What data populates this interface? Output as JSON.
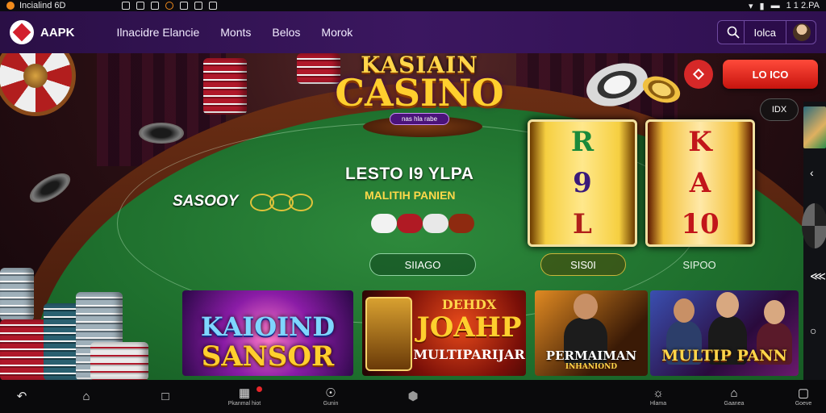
{
  "status_bar": {
    "app_name": "Incialind 6D",
    "time": "1 1 2.PA"
  },
  "navbar": {
    "brand": "AAPK",
    "links": [
      "Ilnacidre Elancie",
      "Monts",
      "Belos",
      "Morok"
    ],
    "login_label": "Iolca"
  },
  "hero": {
    "logo_line1": "KASIAIN",
    "logo_line2": "CASINO",
    "logo_badge": "nas hla rabe",
    "headline": "LESTO I9 YLPA",
    "subline": "MALITIH PANIEN",
    "left_text": "SASOOY",
    "cta_label": "LO ICO",
    "speed_label": "IDX",
    "buttons": [
      "SIIAGO",
      "SIS0I",
      "SIPOO"
    ]
  },
  "reels": [
    [
      "R",
      "9",
      "L"
    ],
    [
      "K",
      "A",
      "10"
    ]
  ],
  "cards": [
    {
      "line1": "KAIOIND",
      "line2": "SANSOR"
    },
    {
      "line1": "JOAHP",
      "line2": "MULTIPARIJAR",
      "top": "DEHDX"
    },
    {
      "line1": "PERMAIMAN",
      "line2": "INHANIOND"
    },
    {
      "line1": "MULTIP PANN",
      "line2": ""
    }
  ],
  "bottom_nav": {
    "items": [
      {
        "icon": "back-icon",
        "label": ""
      },
      {
        "icon": "home-icon",
        "label": ""
      },
      {
        "icon": "tabs-icon",
        "label": ""
      },
      {
        "icon": "games-icon",
        "label": "Pkanmal hiot"
      },
      {
        "icon": "compass-icon",
        "label": "Gunin"
      },
      {
        "icon": "shield-icon",
        "label": ""
      },
      {
        "icon": "explore-icon",
        "label": "Hlama"
      },
      {
        "icon": "profile-icon",
        "label": "Gaanea"
      },
      {
        "icon": "square-icon",
        "label": "Goeve"
      }
    ]
  },
  "colors": {
    "nav_bg": "#2a0f45",
    "accent_red": "#d62828",
    "gold": "#ffcf2e",
    "felt": "#1c6b2b"
  }
}
